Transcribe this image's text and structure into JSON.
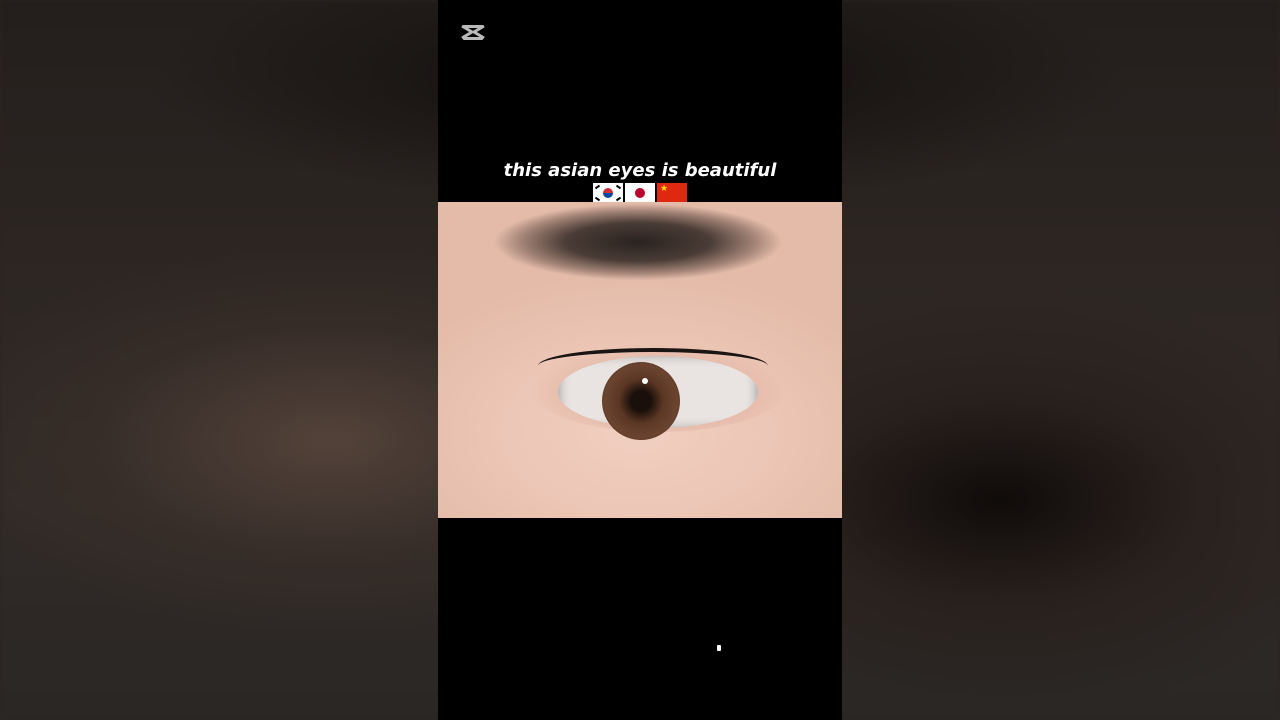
{
  "video": {
    "caption": "this asian eyes is beautiful",
    "flags": [
      "south-korea-flag",
      "japan-flag",
      "china-flag"
    ],
    "logo": "capcut-logo-icon"
  },
  "colors": {
    "panel_background": "#000000",
    "caption_text": "#ffffff"
  }
}
